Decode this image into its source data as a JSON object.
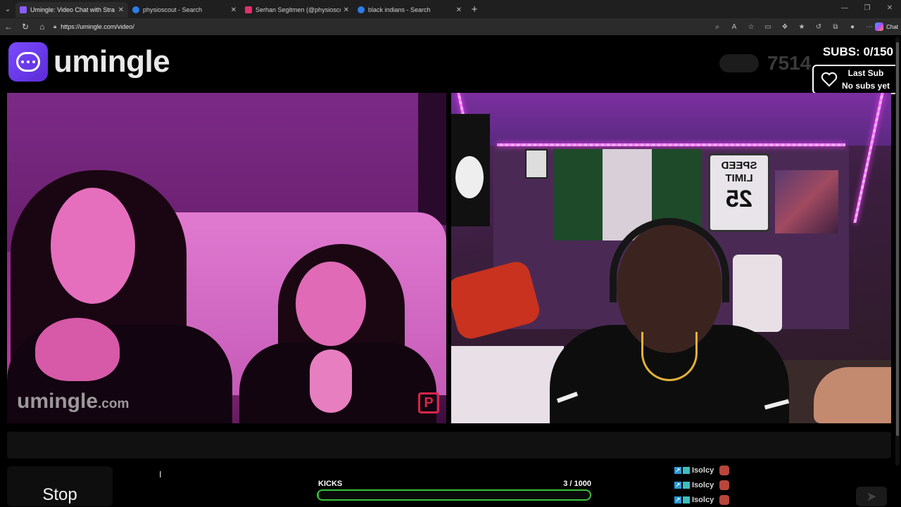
{
  "browser": {
    "tabs": [
      {
        "label": "Umingle: Video Chat with Stra",
        "favicon_color": "#8a5cff",
        "active": true
      },
      {
        "label": "physioscout - Search",
        "favicon_color": "#2b7de9",
        "active": false
      },
      {
        "label": "Serhan Segitmen (@physioscout)",
        "favicon_color": "#e1306c",
        "active": false
      },
      {
        "label": "black indians - Search",
        "favicon_color": "#2b7de9",
        "active": false
      }
    ],
    "url": "https://umingle.com/video/",
    "chat_button": "Chat"
  },
  "site": {
    "logo_text": "umingle",
    "online_count": "7514"
  },
  "overlay": {
    "subs_title": "SUBS: 0/150",
    "last_sub_label": "Last Sub",
    "last_sub_value": "No subs yet"
  },
  "video_left": {
    "watermark_main": "umingle",
    "watermark_suffix": ".com",
    "corner_mark": "P"
  },
  "video_right": {
    "sign_line1": "SPEED",
    "sign_line2": "LIMIT",
    "sign_number": "25"
  },
  "controls": {
    "stop_label": "Stop",
    "message_value": ""
  },
  "kicks": {
    "label": "KICKS",
    "current": 3,
    "max": 1000,
    "display": "3  / 1000",
    "color": "#38c23a"
  },
  "feed": [
    {
      "user": "Isolcy"
    },
    {
      "user": "Isolcy"
    },
    {
      "user": "Isolcy"
    }
  ],
  "colors": {
    "brand": "#7a4bff",
    "accent_led": "#ff40ff"
  }
}
